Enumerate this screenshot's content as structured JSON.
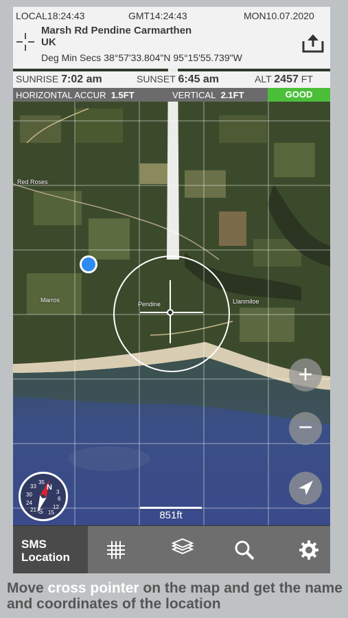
{
  "header": {
    "local_label": "LOCAL",
    "local_time": "18:24:43",
    "gmt_label": "GMT",
    "gmt_time": "14:24:43",
    "day": "MON",
    "date": "10.07.2020",
    "location_line1": "Marsh Rd Pendine Carmarthen",
    "location_line2": "UK",
    "coord_format": "Deg Min Secs",
    "latitude": "38°57'33.804\"N",
    "longitude": "95°15'55.739\"W"
  },
  "sun": {
    "sunrise_label": "SUNRISE",
    "sunrise_time": "7:02 am",
    "sunset_label": "SUNSET",
    "sunset_time": "6:45 am",
    "alt_label": "ALT",
    "alt_value": "2457",
    "alt_unit": "FT"
  },
  "accuracy": {
    "horizontal_label": "HORIZONTAL ACCUR",
    "horizontal_value": "1.5FT",
    "vertical_label": "VERTICAL",
    "vertical_value": "2.1FT",
    "status": "GOOD"
  },
  "map": {
    "places": [
      "Red Roses",
      "Marros",
      "Pendine",
      "Llanmiloe"
    ],
    "scale": "851ft",
    "zoom_in": "+",
    "zoom_out": "−"
  },
  "compass": {
    "north": "N",
    "south": "S",
    "ticks": [
      "3",
      "6",
      "12",
      "15",
      "21",
      "24",
      "30",
      "33",
      "35"
    ]
  },
  "toolbar": {
    "sms_line1": "SMS",
    "sms_line2": "Location"
  },
  "caption": {
    "part1": "Move ",
    "highlight": "cross pointer",
    "part2": " on the map and get the name and coordinates of the location"
  },
  "colors": {
    "good": "#4cbf3a",
    "my_location": "#2e8cf0",
    "toolbar": "#6e6e6e"
  }
}
